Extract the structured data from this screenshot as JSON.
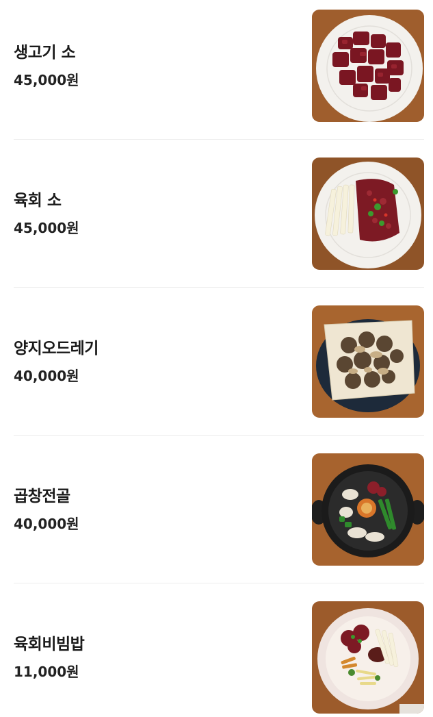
{
  "menu": {
    "items": [
      {
        "name": "생고기 소",
        "price": "45,000원",
        "image": "raw-beef-plate"
      },
      {
        "name": "육회 소",
        "price": "45,000원",
        "image": "yukhoe-plate"
      },
      {
        "name": "양지오드레기",
        "price": "40,000원",
        "image": "brisket-odregi-plate"
      },
      {
        "name": "곱창전골",
        "price": "40,000원",
        "image": "gopchang-jeongol-pot"
      },
      {
        "name": "육회비빔밥",
        "price": "11,000원",
        "image": "yukhoe-bibimbap-bowl"
      }
    ]
  },
  "colors": {
    "wood": "#9a5a2a",
    "plate": "#f2f0ec",
    "meat": "#7a1622",
    "divider": "#ececec"
  }
}
